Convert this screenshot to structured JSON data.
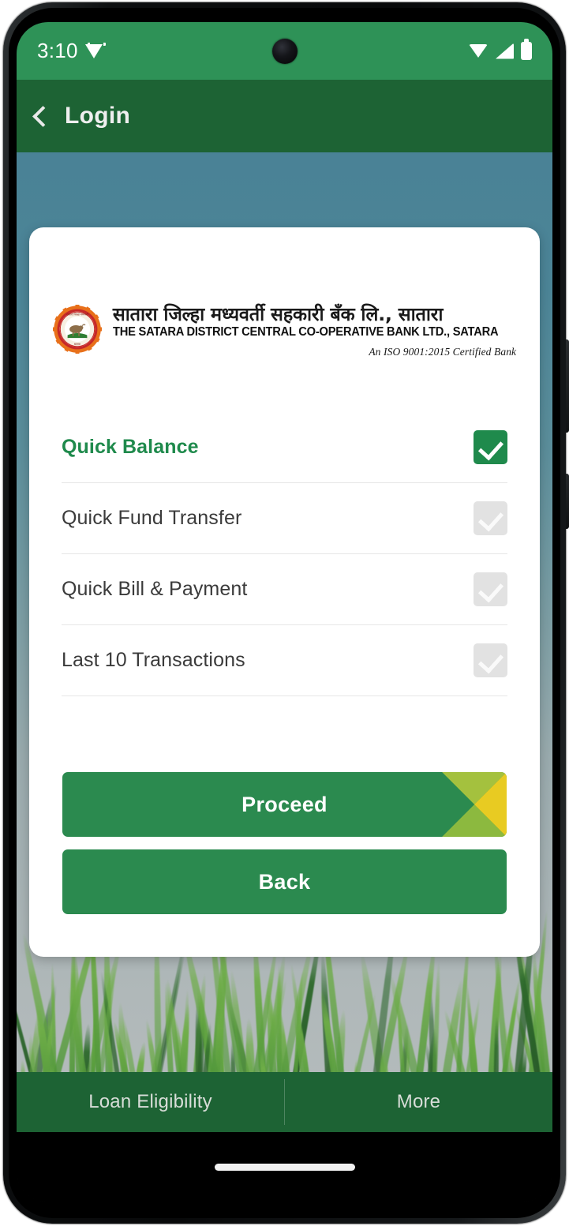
{
  "status_bar": {
    "time": "3:10",
    "icons": [
      "notification-icon",
      "wifi-icon",
      "cellular-signal-icon",
      "battery-icon"
    ]
  },
  "app_bar": {
    "back_icon": "chevron-left-icon",
    "title": "Login"
  },
  "card": {
    "logo": {
      "emblem_alt": "bank-emblem",
      "marathi_name": "सातारा जिल्हा मध्यवर्ती सहकारी बँक लि., सातारा",
      "english_name": "THE SATARA DISTRICT CENTRAL CO-OPERATIVE BANK LTD., SATARA",
      "certification": "An ISO 9001:2015 Certified Bank"
    },
    "services": [
      {
        "label": "Quick Balance",
        "checked": true,
        "enabled": true
      },
      {
        "label": "Quick Fund Transfer",
        "checked": false,
        "enabled": false
      },
      {
        "label": "Quick Bill & Payment",
        "checked": false,
        "enabled": false
      },
      {
        "label": "Last 10 Transactions",
        "checked": false,
        "enabled": false
      }
    ],
    "buttons": {
      "proceed": "Proceed",
      "back": "Back"
    }
  },
  "bottom_nav": {
    "items": [
      {
        "label": "Loan Eligibility"
      },
      {
        "label": "More"
      }
    ]
  },
  "colors": {
    "status_bar_green": "#2e9257",
    "app_bar_green": "#1d6334",
    "accent_green": "#1f8a4c",
    "button_green": "#2b8a4f",
    "deco_yellow": "#e8cb22",
    "deco_olive": "#a4c13e",
    "checkbox_disabled": "#e2e2e2",
    "card_white": "#ffffff"
  }
}
